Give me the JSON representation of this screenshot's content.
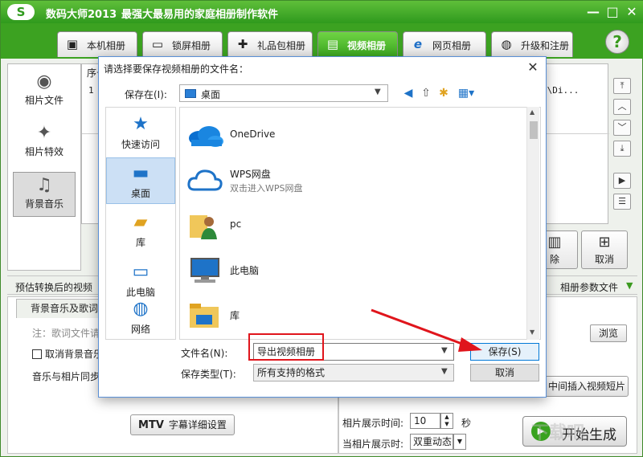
{
  "app": {
    "logo_text": "S",
    "title": "数码大师2013",
    "slogan": "最强大最易用的家庭相册制作软件",
    "window_buttons": [
      "—",
      "□",
      "✕"
    ]
  },
  "tabs": [
    {
      "label": "本机相册",
      "icon": "person-frame-icon",
      "active": false
    },
    {
      "label": "锁屏相册",
      "icon": "monitor-icon",
      "active": false
    },
    {
      "label": "礼品包相册",
      "icon": "gift-icon",
      "active": false
    },
    {
      "label": "视频相册",
      "icon": "film-icon",
      "active": true
    },
    {
      "label": "网页相册",
      "icon": "ie-icon",
      "active": false
    },
    {
      "label": "升级和注册",
      "icon": "globe-icon",
      "active": false
    }
  ],
  "help_label": "?",
  "sidebar": {
    "items": [
      {
        "label": "相片文件",
        "icon": "camera-icon"
      },
      {
        "label": "相片特效",
        "icon": "sparkle-icon"
      },
      {
        "label": "背景音乐",
        "icon": "music-note-icon"
      }
    ]
  },
  "list": {
    "header": "序号",
    "row_index": "1",
    "row_path": ")\\Di..."
  },
  "arrow_buttons": [
    "⤒",
    "︿",
    "﹀",
    "⤓",
    "▶",
    "☰"
  ],
  "big_buttons": [
    {
      "label": "除",
      "icon": "trash-icon"
    },
    {
      "label": "取消",
      "icon": "grid-icon"
    }
  ],
  "estimate_text": "预估转换后的视频",
  "param_file": "相册参数文件",
  "music_tab": "背景音乐及歌词",
  "lyric_hint": "注：歌词文件请",
  "cancel_bg_music": "取消背景音乐",
  "sync_label": "音乐与相片同步",
  "mtv_button": {
    "prefix": "MTV",
    "label": "字幕详细设置"
  },
  "browse_button": "浏览",
  "insert_button": "中间插入视频短片",
  "photo_time": {
    "label": "相片展示时间:",
    "value": "10",
    "unit": "秒"
  },
  "photo_effect": {
    "label": "当相片展示时:",
    "value": "双重动态"
  },
  "start_button": "开始生成",
  "dialog": {
    "title": "请选择要保存视频相册的文件名：",
    "close": "✕",
    "save_in_label": "保存在(I):",
    "save_in_value": "桌面",
    "places": [
      {
        "label": "快速访问",
        "icon": "star-icon",
        "active": false
      },
      {
        "label": "桌面",
        "icon": "desktop-icon",
        "active": true
      },
      {
        "label": "库",
        "icon": "library-icon",
        "active": false
      },
      {
        "label": "此电脑",
        "icon": "computer-icon",
        "active": false
      },
      {
        "label": "网络",
        "icon": "network-icon",
        "active": false
      }
    ],
    "files": [
      {
        "name": "OneDrive",
        "sub": "",
        "icon": "onedrive-cloud-icon"
      },
      {
        "name": "WPS网盘",
        "sub": "双击进入WPS网盘",
        "icon": "wps-cloud-icon"
      },
      {
        "name": "pc",
        "sub": "",
        "icon": "user-folder-icon"
      },
      {
        "name": "此电脑",
        "sub": "",
        "icon": "computer-icon"
      },
      {
        "name": "库",
        "sub": "",
        "icon": "library-folder-icon"
      }
    ],
    "filename_label": "文件名(N):",
    "filename_value": "导出视频相册",
    "filetype_label": "保存类型(T):",
    "filetype_value": "所有支持的格式",
    "save_button": "保存(S)",
    "cancel_button": "取消"
  },
  "colors": {
    "brand_green": "#3ca221",
    "highlight_red": "#e0151c",
    "dialog_accent": "#0078d7"
  },
  "watermark": "下载吧"
}
